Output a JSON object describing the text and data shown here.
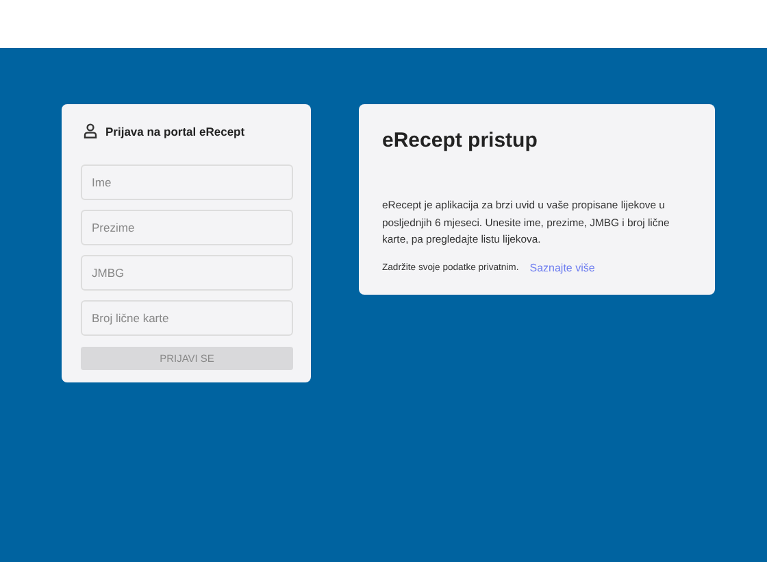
{
  "login": {
    "title": "Prijava na portal eRecept",
    "fields": [
      {
        "placeholder": "Ime"
      },
      {
        "placeholder": "Prezime"
      },
      {
        "placeholder": "JMBG"
      },
      {
        "placeholder": "Broj lične karte"
      }
    ],
    "button": {
      "label": "PRIJAVI SE",
      "disabled": true
    }
  },
  "info": {
    "title": "eRecept pristup",
    "text": "eRecept je aplikacija za brzi uvid u vaše propisane lijekove u posljednjih 6 mjeseci. Unesite ime, prezime, JMBG i broj lične karte, pa pregledajte listu lijekova.",
    "note": "Zadržite svoje podatke privatnim.",
    "link": "Saznajte više"
  }
}
